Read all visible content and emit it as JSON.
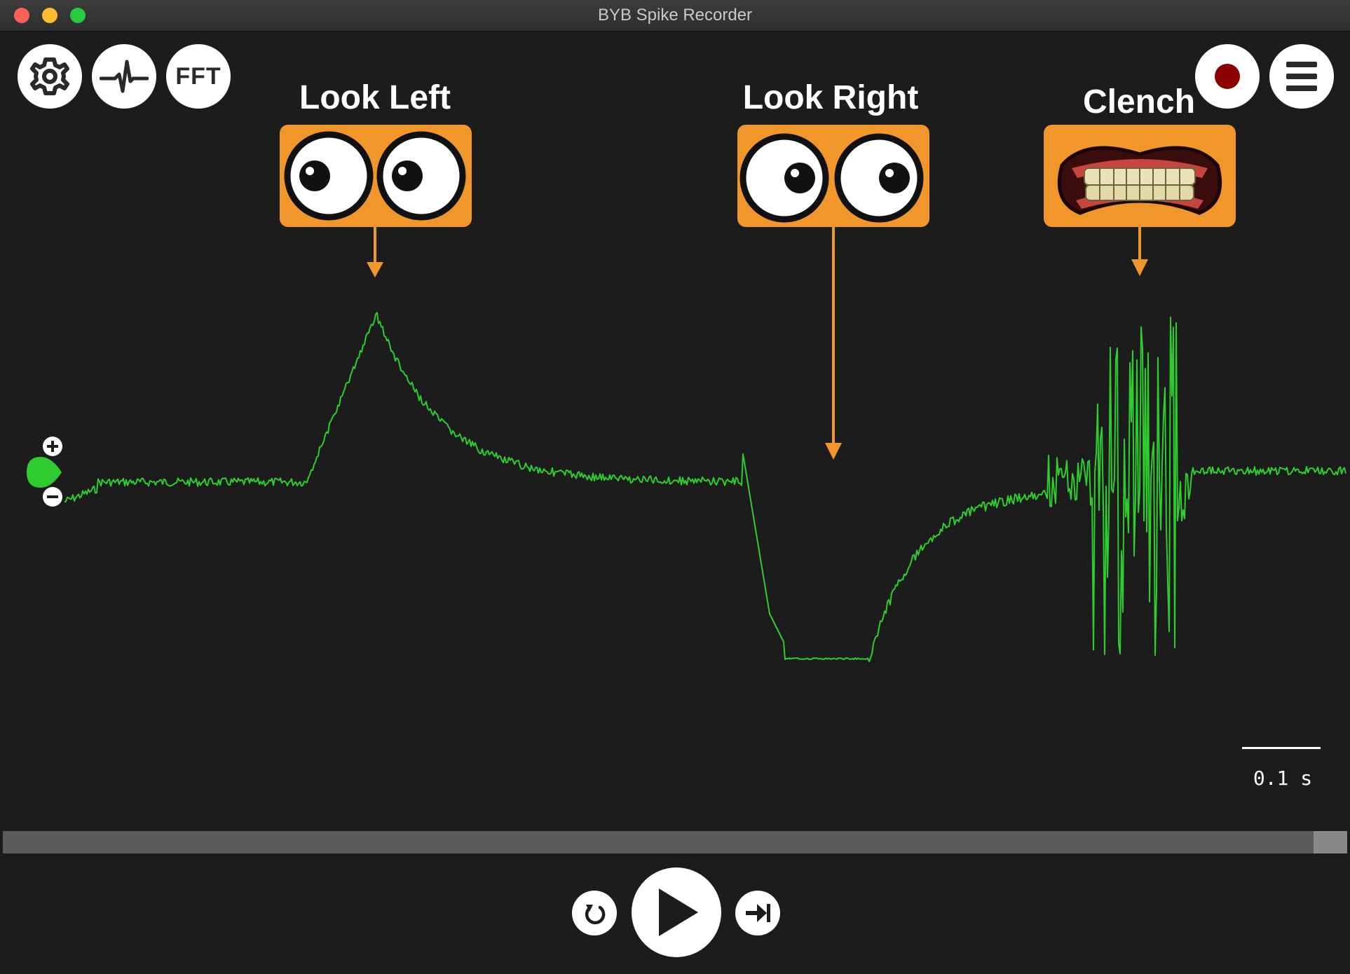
{
  "window": {
    "title": "BYB Spike Recorder"
  },
  "toolbar": {
    "settings_icon": "gear-icon",
    "threshold_icon": "spike-waveform-icon",
    "fft_label": "FFT",
    "record_icon": "record-dot-icon",
    "menu_icon": "hamburger-menu-icon",
    "record_color": "#8b0000"
  },
  "annotations": [
    {
      "title": "Look Left",
      "image": "eyes-looking-left"
    },
    {
      "title": "Look Right",
      "image": "eyes-looking-right"
    },
    {
      "title": "Clench",
      "image": "clenched-teeth-mouth"
    }
  ],
  "channel": {
    "gain_plus_icon": "plus-icon",
    "gain_minus_icon": "minus-icon",
    "handle_color": "#2ecc2e",
    "signal_color": "#2ecc2e"
  },
  "time_scale": {
    "label": "0.1 s"
  },
  "playback": {
    "rewind_icon": "rewind-icon",
    "play_icon": "play-icon",
    "skip_end_icon": "skip-to-end-icon"
  },
  "colors": {
    "annotation_box": "#f0962a",
    "arrow": "#f0962a"
  }
}
